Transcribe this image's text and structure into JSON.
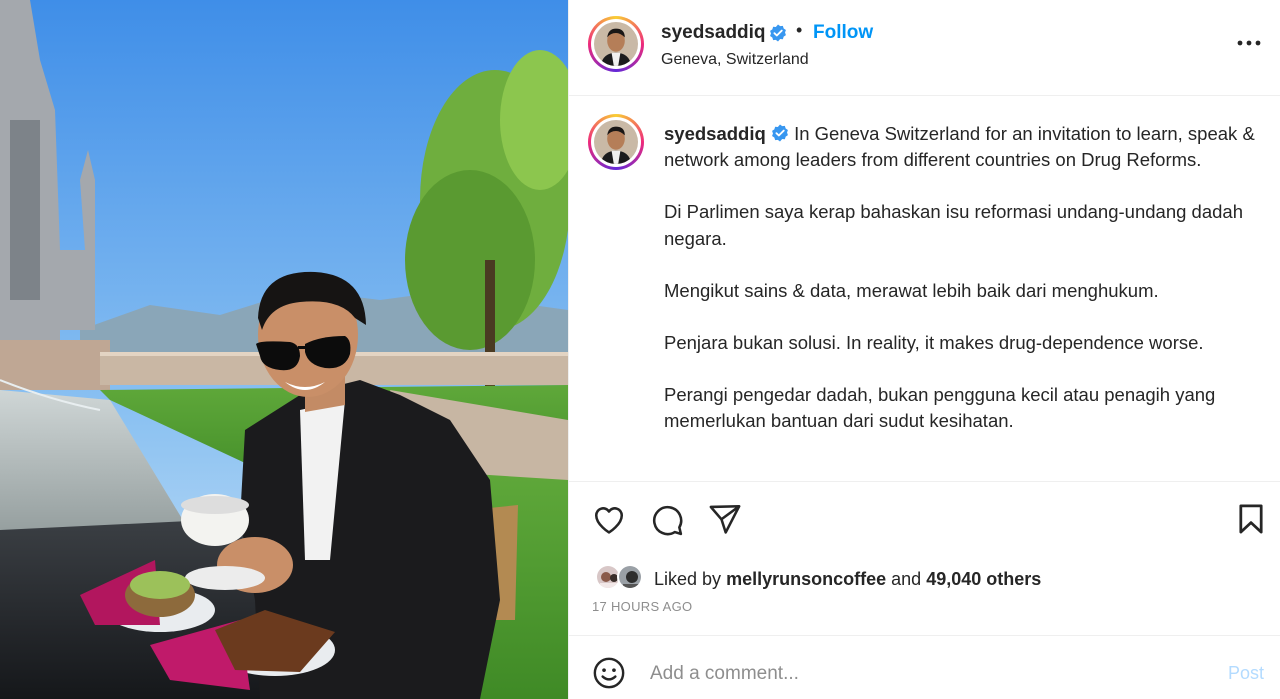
{
  "header": {
    "username": "syedsaddiq",
    "dot": "•",
    "follow_label": "Follow",
    "location": "Geneva, Switzerland"
  },
  "caption": {
    "username": "syedsaddiq",
    "first_line": "In Geneva Switzerland for an invitation to learn, speak & network among leaders from different countries on Drug Reforms.",
    "paragraphs": [
      "Di Parlimen saya kerap bahaskan isu reformasi undang-undang dadah negara.",
      "Mengikut sains & data, merawat lebih baik dari menghukum.",
      "Penjara bukan solusi. In reality, it makes drug-dependence worse.",
      "Perangi pengedar dadah, bukan pengguna kecil atau penagih yang memerlukan bantuan dari sudut kesihatan."
    ]
  },
  "actions": {
    "icons": [
      "heart-icon",
      "comment-icon",
      "share-icon",
      "bookmark-icon"
    ]
  },
  "likes": {
    "prefix": "Liked by",
    "user": "mellyrunsoncoffee",
    "conj": "and",
    "others": "49,040 others"
  },
  "timestamp": "17 HOURS AGO",
  "comment": {
    "placeholder": "Add a comment...",
    "post_label": "Post"
  },
  "colors": {
    "link_blue": "#0095f6",
    "verified_blue": "#3897f0",
    "post_disabled": "#b3dbff",
    "muted": "#8e8e8e"
  }
}
